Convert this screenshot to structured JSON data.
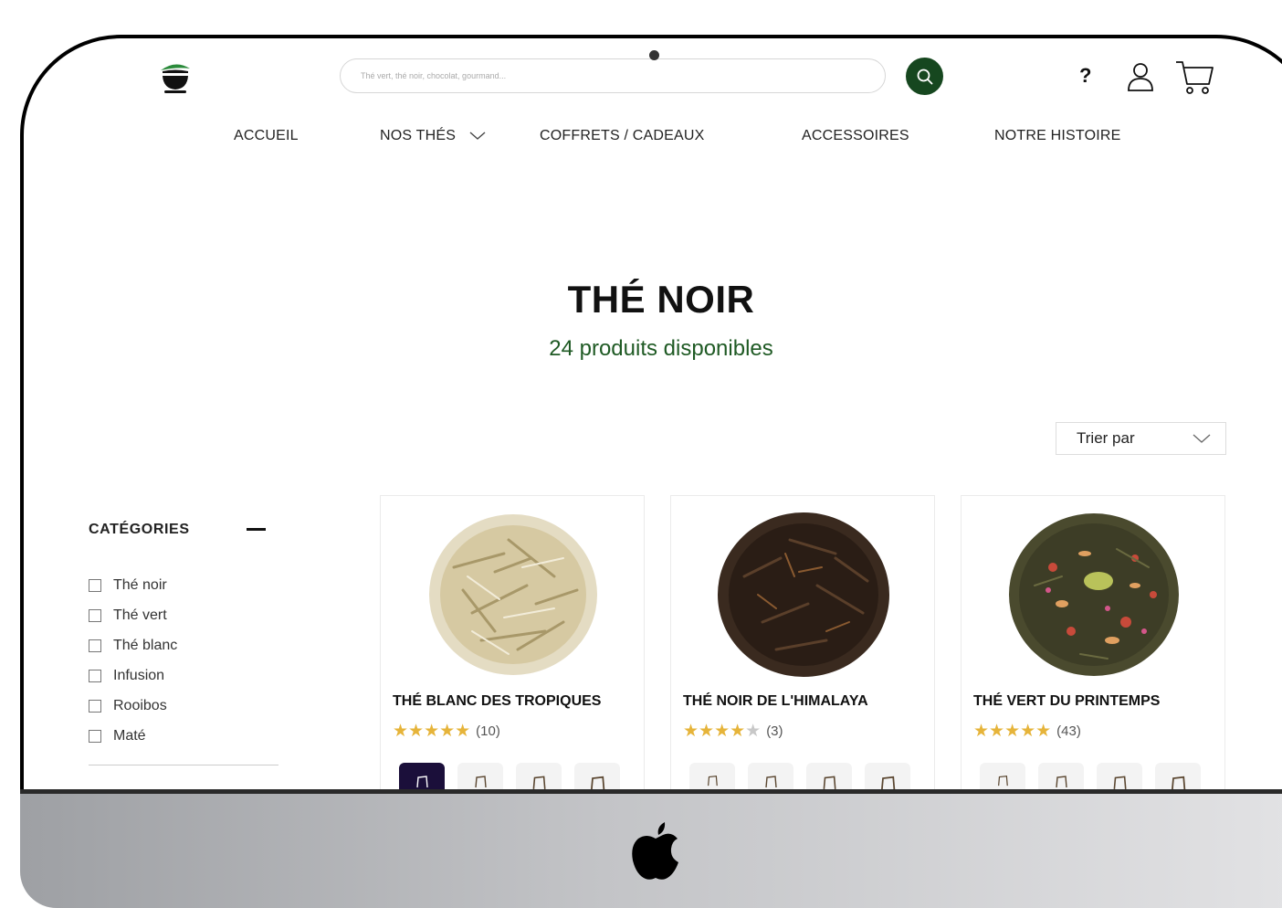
{
  "header": {
    "search_placeholder": "Thé vert, thé noir, chocolat, gourmand...",
    "help_label": "?",
    "icons": [
      "tea-cup-logo-icon",
      "search-icon",
      "user-icon",
      "cart-icon"
    ]
  },
  "nav": {
    "items": [
      "ACCUEIL",
      "NOS THÉS",
      "COFFRETS / CADEAUX",
      "ACCESSOIRES",
      "NOTRE HISTOIRE"
    ]
  },
  "page": {
    "title": "THÉ NOIR",
    "subtitle": "24 produits disponibles"
  },
  "sort": {
    "label": "Trier par"
  },
  "sidebar": {
    "title": "CATÉGORIES",
    "categories": [
      "Thé noir",
      "Thé vert",
      "Thé blanc",
      "Infusion",
      "Rooibos",
      "Maté"
    ]
  },
  "products": [
    {
      "name": "THÉ BLANC DES TROPIQUES",
      "rating": 5,
      "reviews": "(10)"
    },
    {
      "name": "THÉ NOIR DE L'HIMALAYA",
      "rating": 4,
      "reviews": "(3)"
    },
    {
      "name": "THÉ VERT DU PRINTEMPS",
      "rating": 5,
      "reviews": "(43)"
    }
  ],
  "colors": {
    "brand_green": "#16471f",
    "subtitle_green": "#1f5a24",
    "star_gold": "#e6b43a",
    "active_swatch": "#1b0f3a"
  }
}
